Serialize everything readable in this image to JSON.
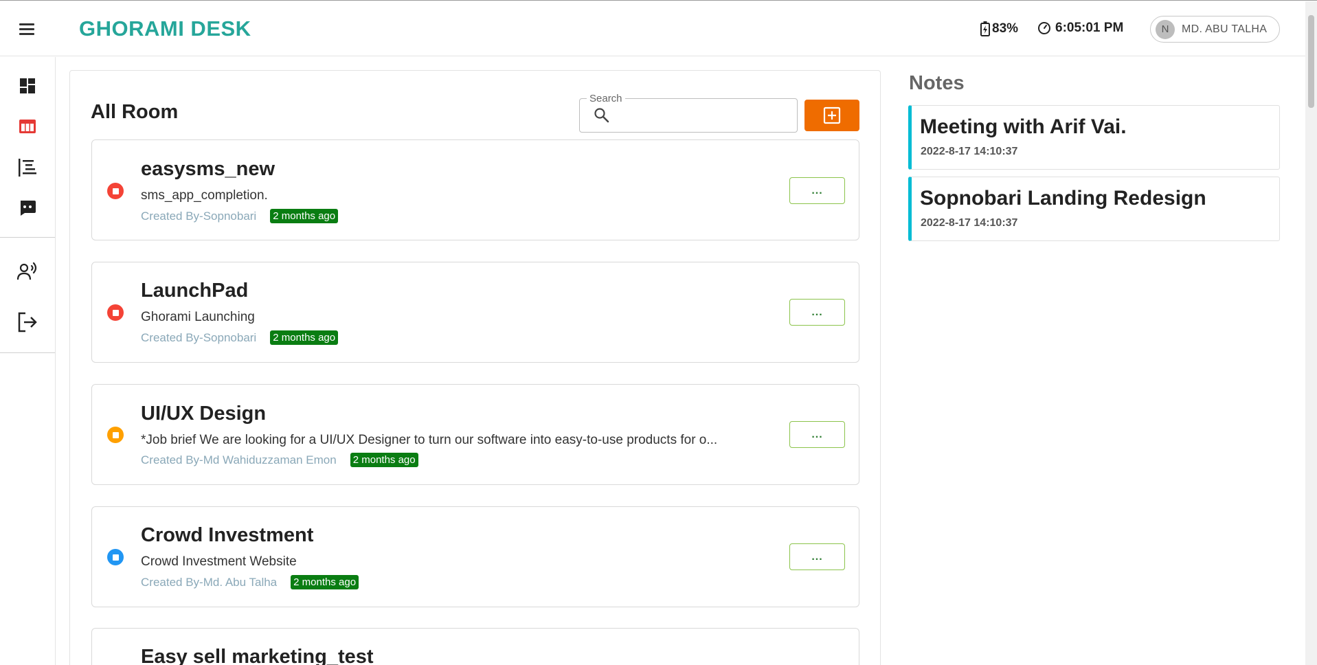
{
  "header": {
    "brand": "GHORAMI DESK",
    "battery": "83%",
    "time": "6:05:01 PM",
    "user": {
      "initial": "N",
      "name": "MD. ABU TALHA"
    }
  },
  "sidebar": {
    "items": [
      {
        "name": "dashboard",
        "icon": "dashboard-icon"
      },
      {
        "name": "rooms",
        "icon": "table-columns-icon",
        "active": true,
        "color": "#e53935"
      },
      {
        "name": "tasks",
        "icon": "tree-list-icon"
      },
      {
        "name": "chat",
        "icon": "chat-bubble-icon"
      },
      {
        "name": "meeting",
        "icon": "record-voice-icon"
      },
      {
        "name": "logout",
        "icon": "logout-icon"
      }
    ]
  },
  "rooms": {
    "title": "All Room",
    "search": {
      "label": "Search",
      "value": ""
    },
    "more_label": "...",
    "items": [
      {
        "name": "easysms_new",
        "description": "sms_app_completion.",
        "creator": "Created By-Sopnobari",
        "time": "2 months ago",
        "status_color": "#f44336"
      },
      {
        "name": "LaunchPad",
        "description": "Ghorami Launching",
        "creator": "Created By-Sopnobari",
        "time": "2 months ago",
        "status_color": "#f44336"
      },
      {
        "name": "UI/UX Design",
        "description": "*Job brief We are looking for a UI/UX Designer to turn our software into easy-to-use products for o...",
        "creator": "Created By-Md Wahiduzzaman Emon",
        "time": "2 months ago",
        "status_color": "#ffa000"
      },
      {
        "name": "Crowd Investment",
        "description": "Crowd Investment Website",
        "creator": "Created By-Md. Abu Talha",
        "time": "2 months ago",
        "status_color": "#2196f3"
      },
      {
        "name": "Easy sell marketing_test",
        "description": "",
        "creator": "",
        "time": "",
        "status_color": "#f44336"
      }
    ]
  },
  "notes": {
    "title": "Notes",
    "items": [
      {
        "title": "Meeting with Arif Vai.",
        "date": "2022-8-17 14:10:37"
      },
      {
        "title": "Sopnobari Landing Redesign",
        "date": "2022-8-17 14:10:37"
      }
    ]
  },
  "colors": {
    "brand": "#26a69a",
    "accent": "#ef6c00",
    "badge": "#0a7d12",
    "note_border": "#00bcd4"
  }
}
